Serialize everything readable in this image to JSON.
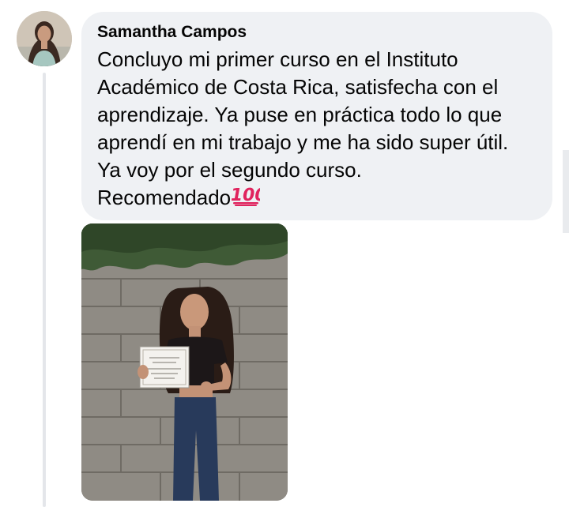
{
  "comment": {
    "author": "Samantha Campos",
    "lines": [
      "Concluyo mi primer curso en el Instituto",
      "Académico de Costa Rica, satisfecha con el",
      "aprendizaje. Ya puse en práctica todo lo que",
      "aprendí en mi trabajo y me ha sido super útil.",
      "Ya voy por el segundo curso.",
      "Recomendado"
    ],
    "emoji": "💯",
    "emoji_icon": "hundred-points-icon",
    "avatar": "avatar",
    "attachment": "attached-photo"
  },
  "colors": {
    "bubble": "#eff1f4",
    "text": "#050505",
    "thread_line": "#e4e6ea",
    "emoji_red": "#e0245e"
  }
}
